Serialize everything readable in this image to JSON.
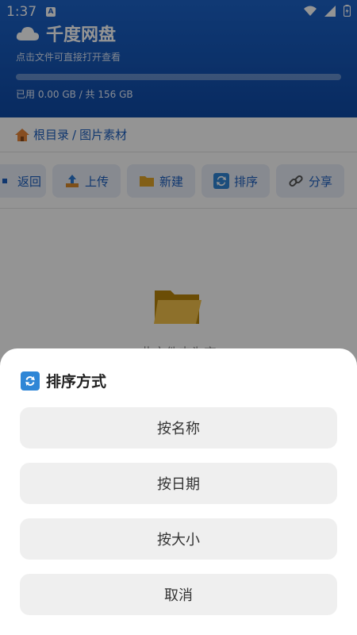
{
  "status_bar": {
    "time": "1:37",
    "notification_badge": "A"
  },
  "header": {
    "title": "千度网盘",
    "subtitle": "点击文件可直接打开查看",
    "storage_text": "已用 0.00 GB / 共 156 GB",
    "storage_used_fraction": 0.0,
    "bg_color": "#1c63c9"
  },
  "breadcrumb": {
    "items": [
      "根目录",
      "图片素材"
    ],
    "separator": "/"
  },
  "toolbar": {
    "buttons": [
      {
        "label": "返回",
        "icon": "back-icon"
      },
      {
        "label": "上传",
        "icon": "upload-icon"
      },
      {
        "label": "新建",
        "icon": "folder-icon"
      },
      {
        "label": "排序",
        "icon": "sort-icon"
      },
      {
        "label": "分享",
        "icon": "link-icon"
      }
    ]
  },
  "content": {
    "empty_text": "此文件夹为空"
  },
  "sort_sheet": {
    "title": "排序方式",
    "options": [
      "按名称",
      "按日期",
      "按大小",
      "取消"
    ]
  }
}
